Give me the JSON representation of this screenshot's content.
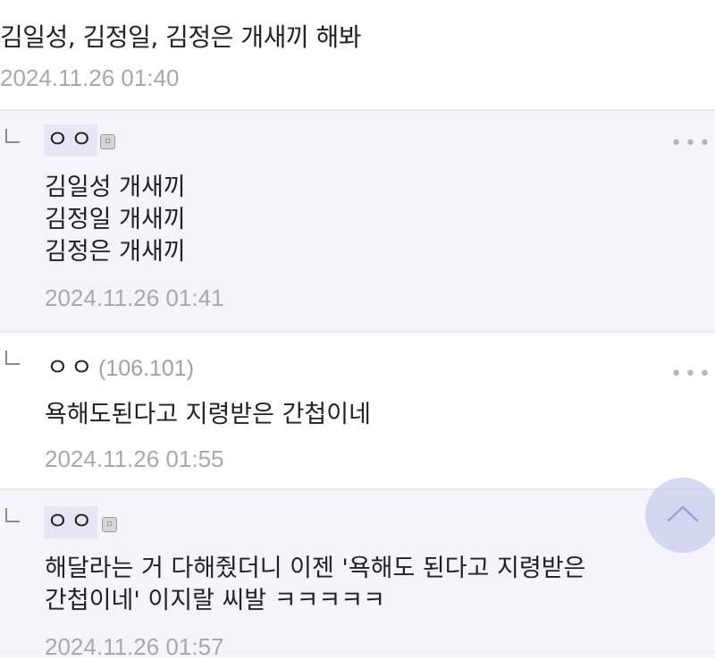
{
  "post": {
    "text": "김일성, 김정일, 김정은 개새끼 해봐",
    "timestamp": "2024.11.26 01:40"
  },
  "comments": [
    {
      "nickname": "ㅇㅇ",
      "badge_icon": "member-badge-icon",
      "ip": "",
      "body": "김일성 개새끼\n김정일 개새끼\n김정은 개새끼",
      "timestamp": "2024.11.26 01:41"
    },
    {
      "nickname": "ㅇㅇ",
      "badge_icon": "",
      "ip": "(106.101)",
      "body": "욕해도된다고 지령받은 간첩이네",
      "timestamp": "2024.11.26 01:55"
    },
    {
      "nickname": "ㅇㅇ",
      "badge_icon": "member-badge-icon",
      "ip": "",
      "body": "해달라는 거 다해줬더니 이젠 '욕해도 된다고 지령받은\n간첩이네' 이지랄 씨발 ㅋㅋㅋㅋㅋ",
      "timestamp": "2024.11.26 01:57"
    }
  ],
  "more_icon": "more-dots-icon",
  "scroll_top_icon": "chevron-up-icon",
  "colors": {
    "shaded_bg": "#f4f4fa",
    "timestamp": "#a8a8ad",
    "scroll_button": "#cdd2ee"
  }
}
